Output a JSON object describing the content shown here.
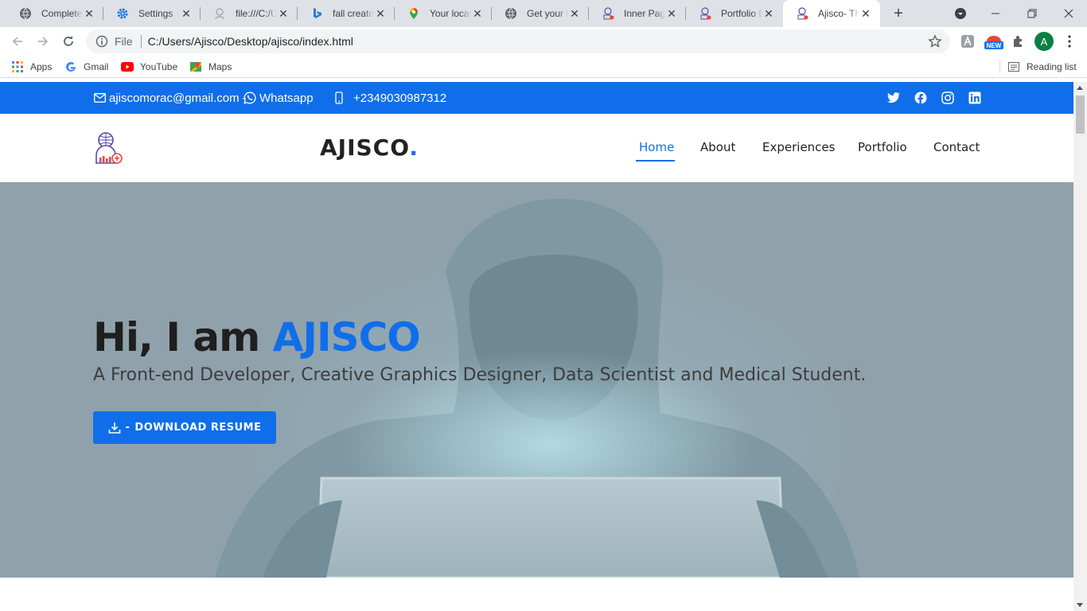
{
  "browser": {
    "tabs": [
      {
        "title": "Complete D",
        "icon": "globe-icon"
      },
      {
        "title": "Settings",
        "icon": "gear-icon"
      },
      {
        "title": "file:///C:/Us",
        "icon": "document-icon"
      },
      {
        "title": "fall creator",
        "icon": "bing-icon"
      },
      {
        "title": "Your locatio",
        "icon": "maps-pin-icon"
      },
      {
        "title": "Get your b",
        "icon": "globe-icon"
      },
      {
        "title": "Inner Page",
        "icon": "site-logo-icon"
      },
      {
        "title": "Portfolio D",
        "icon": "site-logo-icon"
      },
      {
        "title": "Ajisco- The",
        "icon": "site-logo-icon",
        "active": true
      }
    ],
    "address": {
      "scheme": "File",
      "url": "C:/Users/Ajisco/Desktop/ajisco/index.html"
    },
    "profile_initial": "A",
    "new_badge": "NEW",
    "bookmarks": [
      "Apps",
      "Gmail",
      "YouTube",
      "Maps"
    ],
    "reading_list": "Reading list"
  },
  "site": {
    "topbar": {
      "email": "ajiscomorac@gmail.com",
      "separator": "-",
      "whatsapp": "Whatsapp",
      "phone": "+2349030987312",
      "social": [
        "twitter-icon",
        "facebook-icon",
        "instagram-icon",
        "linkedin-icon"
      ]
    },
    "header": {
      "brand": "AJISCO",
      "brand_dot": ".",
      "nav": [
        "Home",
        "About",
        "Experiences",
        "Portfolio",
        "Contact"
      ],
      "active_nav": "Home"
    },
    "hero": {
      "greeting": "Hi, I am ",
      "name": "AJISCO",
      "subtitle": "A Front-end Developer, Creative Graphics Designer, Data Scientist and Medical Student.",
      "button_prefix": "-",
      "button_label": "DOWNLOAD RESUME"
    }
  },
  "colors": {
    "brand_blue": "#106eea",
    "topbar_bg": "#106eea",
    "heading_dark": "#1f1f1f",
    "tabbar_bg": "#dee1e6"
  }
}
